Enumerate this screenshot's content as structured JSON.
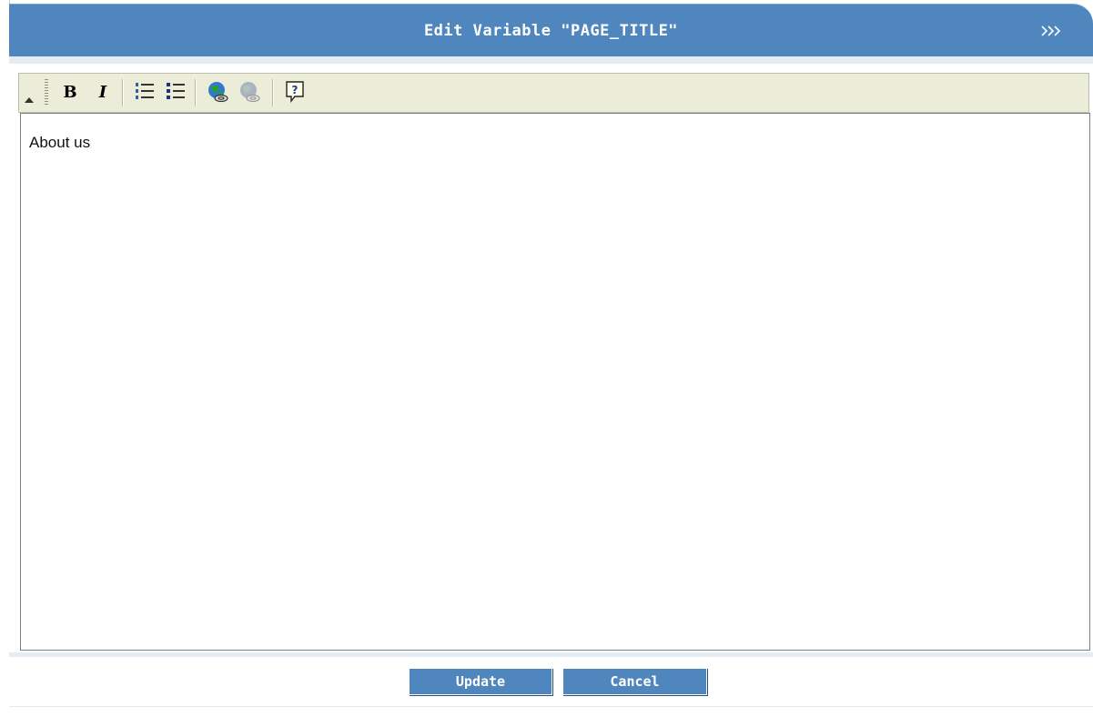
{
  "dialog": {
    "title": "Edit Variable \"PAGE_TITLE\"",
    "collapse_icon": "double-chevron-right-icon"
  },
  "toolbar": {
    "buttons": [
      {
        "name": "bold",
        "label": "B"
      },
      {
        "name": "italic",
        "label": "I"
      },
      {
        "name": "ordered-list",
        "icon": "ordered-list-icon"
      },
      {
        "name": "unordered-list",
        "icon": "unordered-list-icon"
      },
      {
        "name": "insert-link",
        "icon": "globe-link-icon"
      },
      {
        "name": "remove-link",
        "icon": "globe-unlink-icon"
      },
      {
        "name": "help",
        "label": "?"
      }
    ]
  },
  "editor": {
    "content": "About us"
  },
  "actions": {
    "update_label": "Update",
    "cancel_label": "Cancel"
  },
  "colors": {
    "titlebar": "#4f86bd",
    "toolbar": "#ecedd9",
    "button": "#4f86bd"
  }
}
